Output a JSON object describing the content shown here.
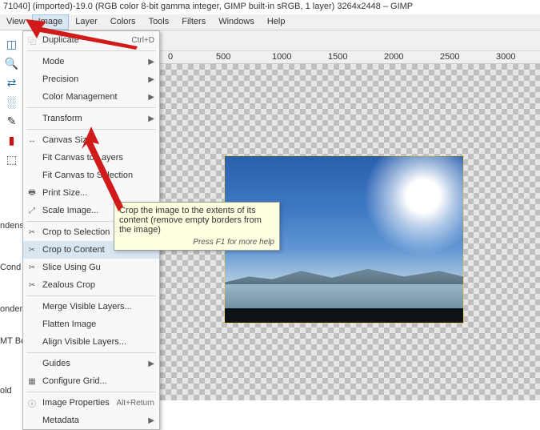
{
  "title": "71040] (imported)-19.0 (RGB color 8-bit gamma integer, GIMP built-in sRGB, 1 layer) 3264x2448 – GIMP",
  "menubar": [
    "View",
    "Image",
    "Layer",
    "Colors",
    "Tools",
    "Filters",
    "Windows",
    "Help"
  ],
  "open_menu_index": 1,
  "ruler": {
    "ticks": [
      "0",
      "500",
      "1000",
      "1500",
      "2000",
      "2500",
      "3000"
    ]
  },
  "side_labels": [
    "ndensed",
    "Cond",
    "ondensed",
    "MT Bold,",
    "old"
  ],
  "menu": {
    "duplicate": {
      "label": "Duplicate",
      "shortcut": "Ctrl+D",
      "icon": "⿻"
    },
    "mode": {
      "label": "Mode"
    },
    "precision": {
      "label": "Precision"
    },
    "color_mgmt": {
      "label": "Color Management"
    },
    "transform": {
      "label": "Transform"
    },
    "canvas_size": {
      "label": "Canvas Size...",
      "icon": "↔"
    },
    "fit_layers": {
      "label": "Fit Canvas to Layers"
    },
    "fit_selection": {
      "label": "Fit Canvas to Selection"
    },
    "print_size": {
      "label": "Print Size...",
      "icon": "🖶"
    },
    "scale_image": {
      "label": "Scale Image...",
      "icon": "⤢"
    },
    "crop_selection": {
      "label": "Crop to Selection",
      "icon": "✂"
    },
    "crop_content": {
      "label": "Crop to Content",
      "icon": "✂"
    },
    "slice": {
      "label": "Slice Using Gu",
      "icon": "✂"
    },
    "zealous": {
      "label": "Zealous Crop",
      "icon": "✂"
    },
    "merge_visible": {
      "label": "Merge Visible Layers..."
    },
    "flatten": {
      "label": "Flatten Image"
    },
    "align_visible": {
      "label": "Align Visible Layers..."
    },
    "guides": {
      "label": "Guides"
    },
    "grid": {
      "label": "Configure Grid...",
      "icon": "▦"
    },
    "properties": {
      "label": "Image Properties",
      "shortcut": "Alt+Return",
      "icon": "ⓘ"
    },
    "metadata": {
      "label": "Metadata"
    }
  },
  "tooltip": {
    "text": "Crop the image to the extents of its content (remove empty borders from the image)",
    "hint": "Press F1 for more help"
  },
  "tool_icons": [
    "◫",
    "🔍",
    "⇄",
    "░",
    "✎",
    "▮",
    "⬚"
  ],
  "accent": "#d8e6f2",
  "arrow_color": "#d11a1a"
}
